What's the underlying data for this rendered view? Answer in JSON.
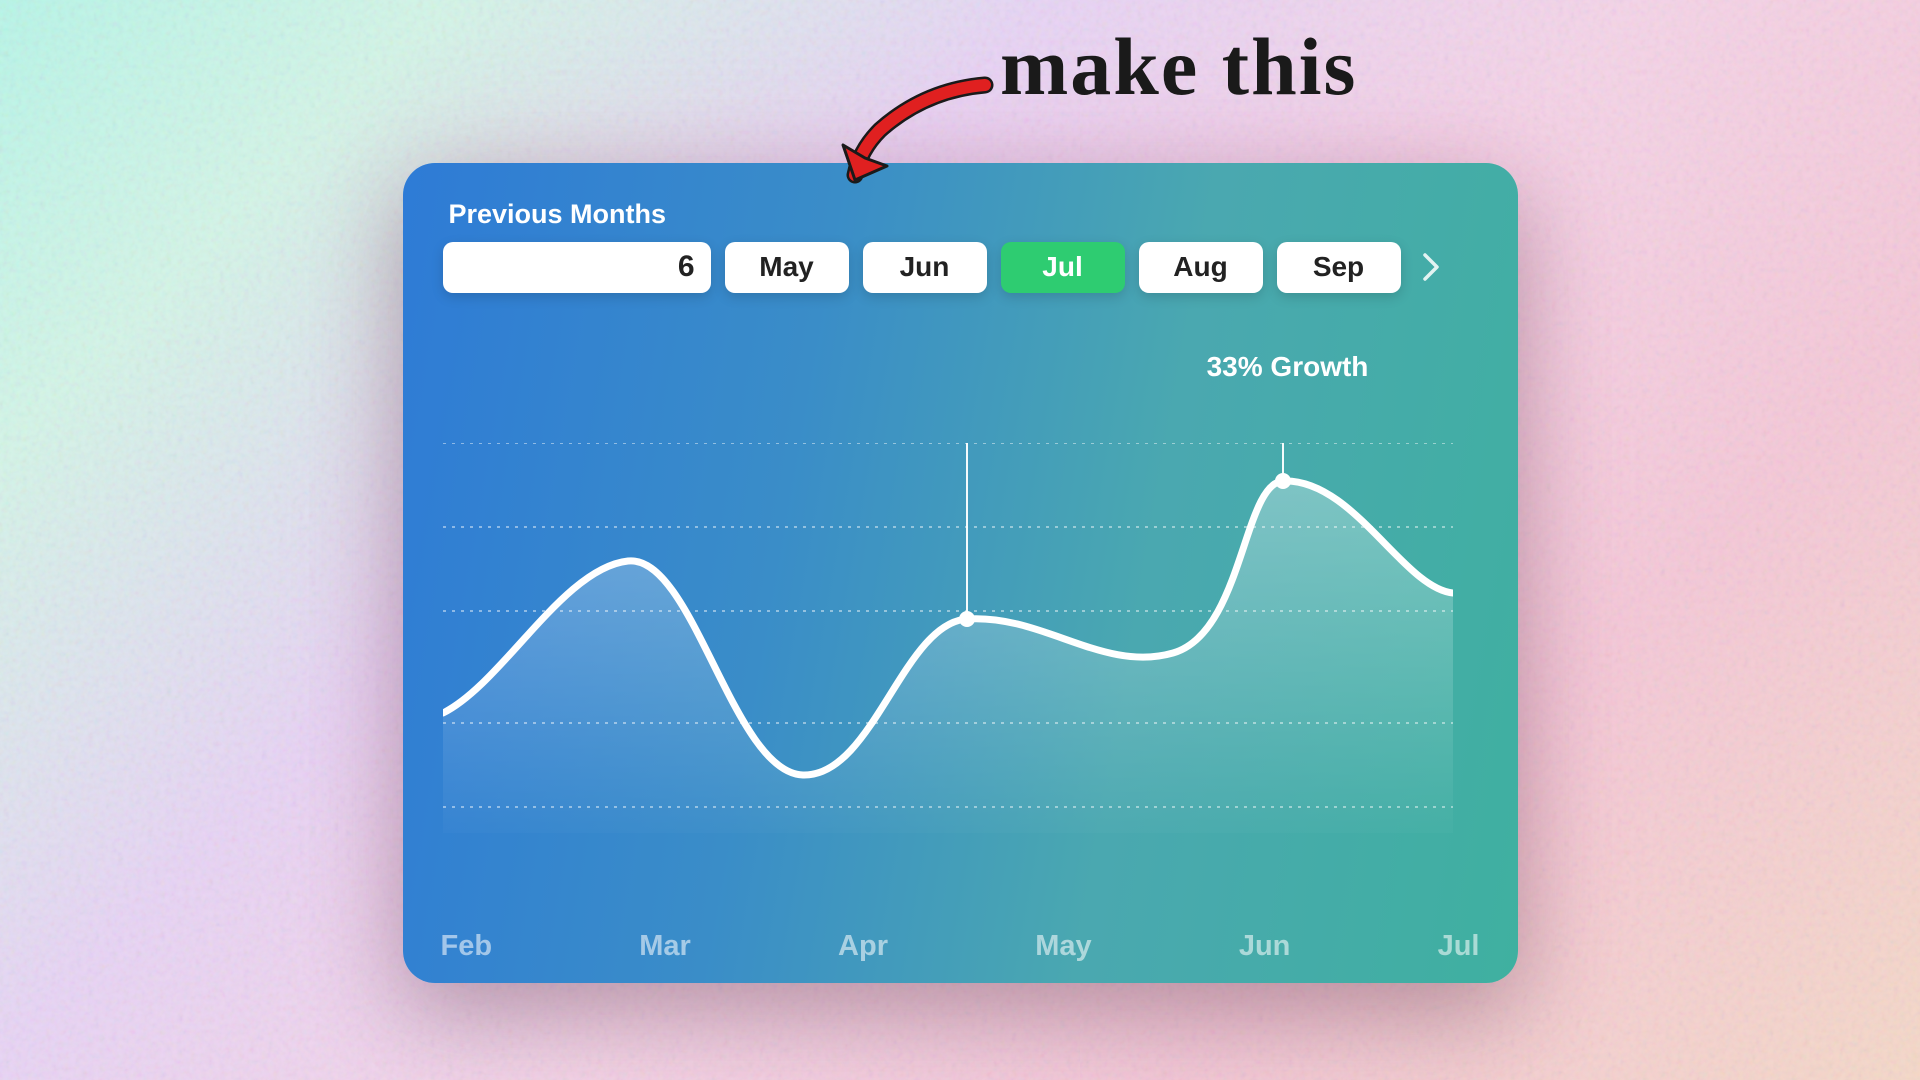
{
  "handwriting_text": "make this",
  "header": {
    "label": "Previous Months",
    "months_input_value": "6",
    "month_buttons": [
      "May",
      "Jun",
      "Jul",
      "Aug",
      "Sep"
    ],
    "selected_index": 2
  },
  "growth_label": "33% Growth",
  "x_ticks": [
    "Feb",
    "Mar",
    "Apr",
    "May",
    "Jun",
    "Jul"
  ],
  "chart_data": {
    "type": "area",
    "title": "Previous Months",
    "xlabel": "",
    "ylabel": "",
    "ylim": [
      0,
      100
    ],
    "x": [
      "Feb",
      "Mar",
      "Apr",
      "May",
      "Jun",
      "Jul"
    ],
    "values": [
      38,
      72,
      10,
      58,
      48,
      100,
      65
    ],
    "annotations": [
      {
        "text": "33% Growth",
        "between": [
          "May-mid",
          "Jun-peak"
        ]
      }
    ],
    "grid": true,
    "legend": false
  },
  "colors": {
    "card_grad_from": "#2e7bd6",
    "card_grad_to": "#3fb0a0",
    "accent": "#2ecc71",
    "line": "#ffffff"
  }
}
